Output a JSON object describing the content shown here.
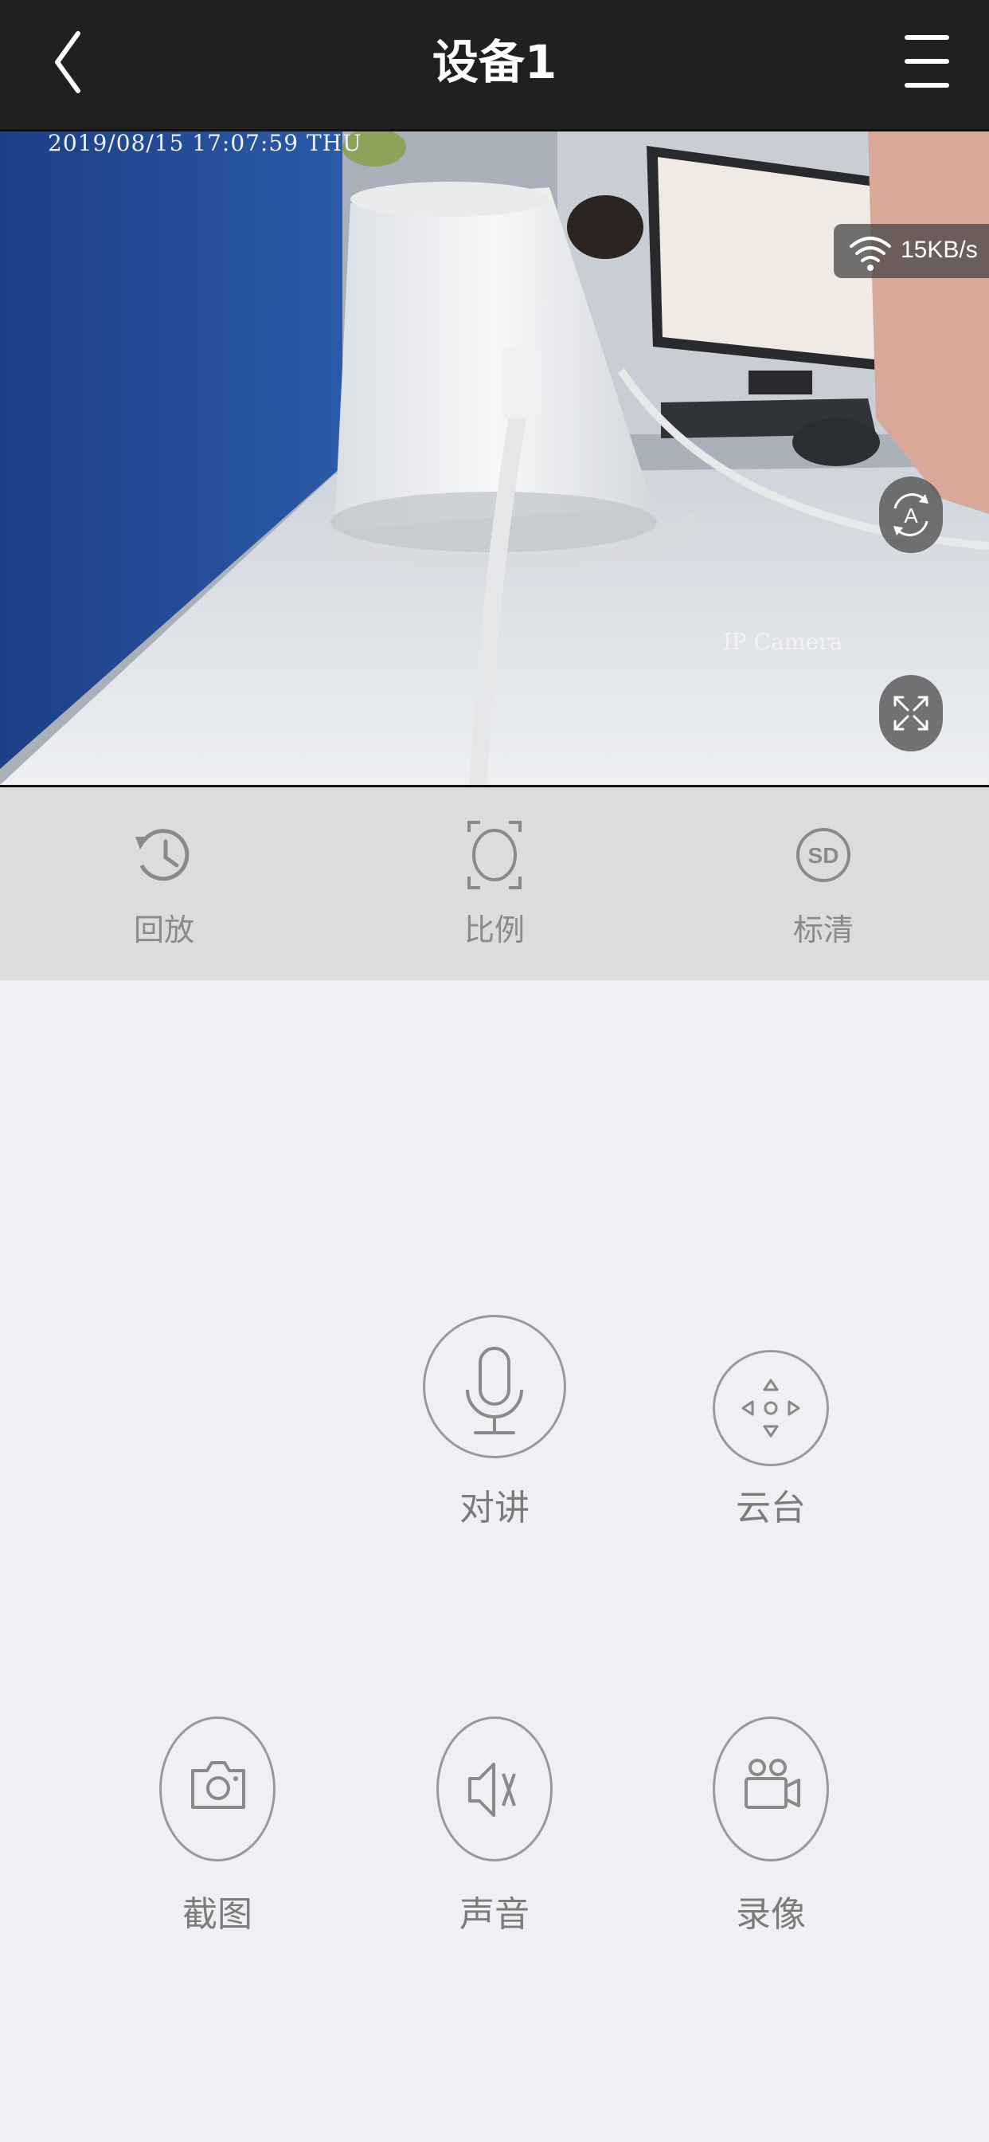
{
  "nav": {
    "title": "设备1",
    "back_icon": "chevron-left-icon",
    "menu_icon": "hamburger-menu-icon"
  },
  "video": {
    "timestamp": "2019/08/15 17:07:59 THU",
    "camera_label": "IP Camera",
    "speed": "15KB/s",
    "wifi_icon": "wifi-icon",
    "auto_icon": "auto-rotate-icon",
    "fullscreen_icon": "fullscreen-icon"
  },
  "toolbar": {
    "items": [
      {
        "label": "回放",
        "icon": "history-icon"
      },
      {
        "label": "比例",
        "icon": "aspect-ratio-icon"
      },
      {
        "label": "标清",
        "icon": "sd-quality-icon"
      }
    ]
  },
  "actions": {
    "talk": {
      "label": "对讲",
      "icon": "microphone-icon"
    },
    "ptz": {
      "label": "云台",
      "icon": "ptz-control-icon"
    },
    "snapshot": {
      "label": "截图",
      "icon": "camera-icon"
    },
    "sound": {
      "label": "声音",
      "icon": "speaker-mute-icon"
    },
    "record": {
      "label": "录像",
      "icon": "video-record-icon"
    }
  },
  "colors": {
    "navbar": "#1f2022",
    "toolbar": "#dcdcdc",
    "page_bg": "#efeff4",
    "icon_gray": "#8a8a8a"
  }
}
